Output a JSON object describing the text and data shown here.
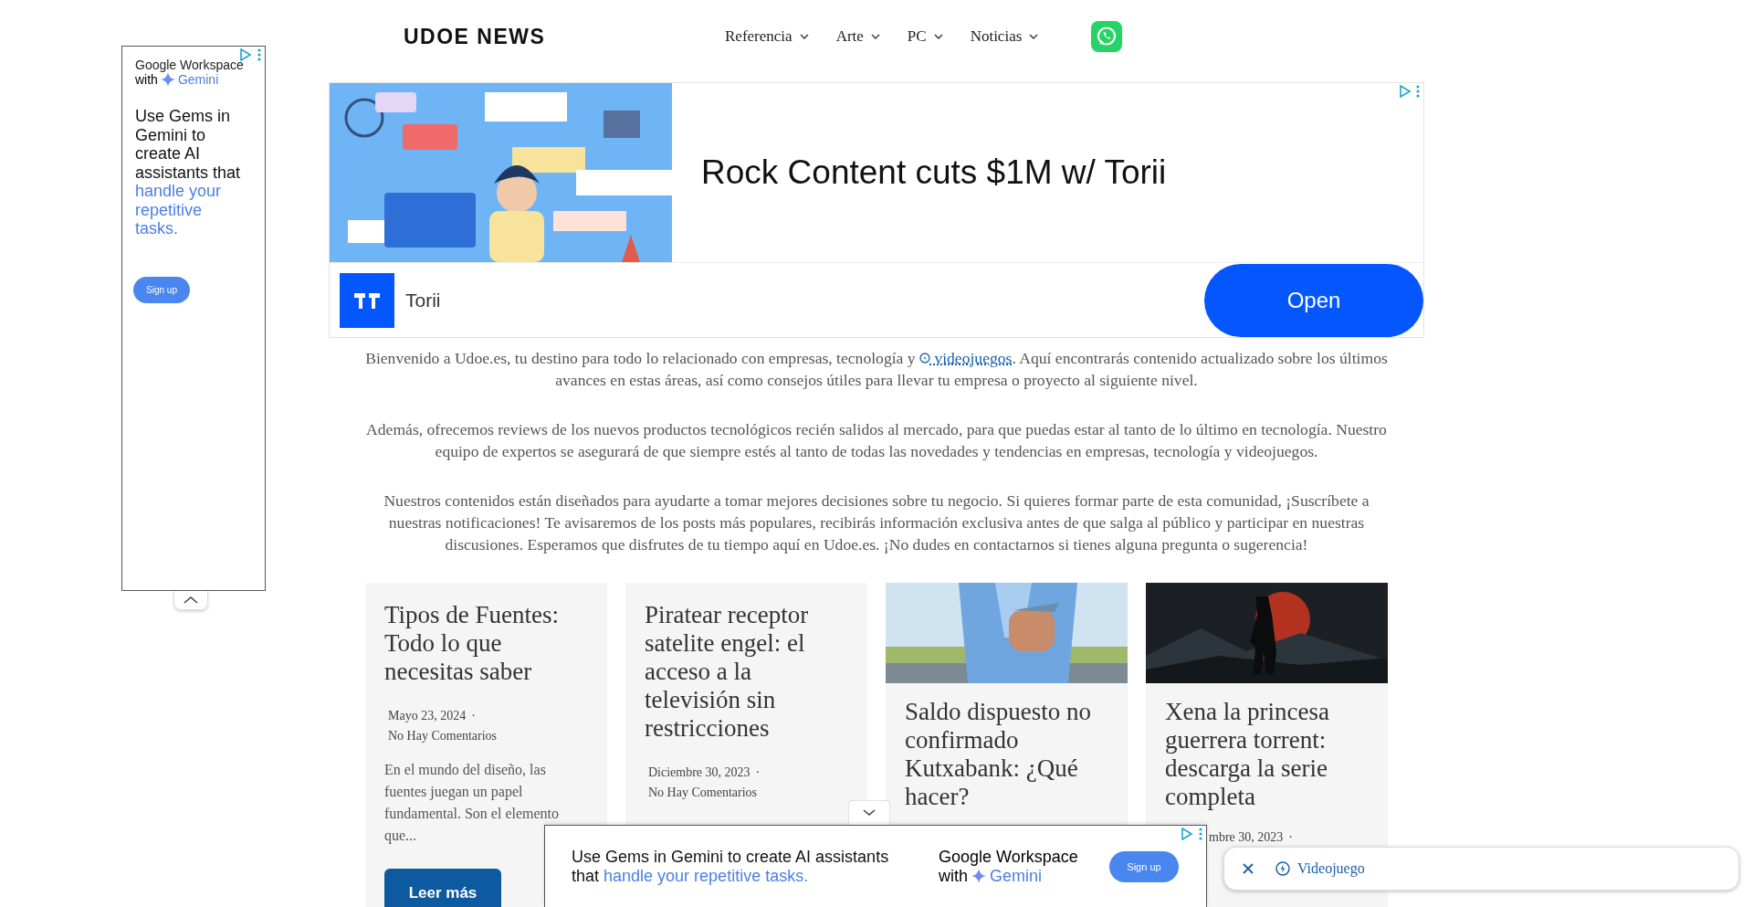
{
  "header": {
    "logo": "UDOE NEWS",
    "nav": [
      {
        "label": "Referencia"
      },
      {
        "label": "Arte"
      },
      {
        "label": "PC"
      },
      {
        "label": "Noticias"
      }
    ]
  },
  "side_ad": {
    "brand": "Google Workspace",
    "brand_with": "with",
    "brand_gemini": "Gemini",
    "headline": "Use Gems in Gemini to create AI assistants that",
    "headline_highlight": "handle your repetitive tasks.",
    "button": "Sign up"
  },
  "banner_ad": {
    "headline": "Rock Content cuts $1M w/ Torii",
    "advertiser": "Torii",
    "button": "Open"
  },
  "intro": {
    "lead": "Bienvenido a Udoe.es, tu destino para todo lo relacionado con empresas, tecnología y",
    "link": "videojuegos",
    "lead_rest": ". Aquí encontrarás contenido actualizado sobre los últimos avances en estas áreas, así como consejos útiles para llevar tu empresa o proyecto al siguiente nivel.",
    "paragraphs": [
      "Además, ofrecemos reviews de los nuevos productos tecnológicos recién salidos al mercado, para que puedas estar al tanto de lo último en tecnología. Nuestro equipo de expertos se asegurará de que siempre estés al tanto de todas las novedades y tendencias en empresas, tecnología y videojuegos.",
      "Nuestros contenidos están diseñados para ayudarte a tomar mejores decisiones sobre tu negocio. Si quieres formar parte de esta comunidad, ¡Suscríbete a nuestras notificaciones! Te avisaremos de los posts más populares, recibirás información exclusiva antes de que salga al público y participar en nuestras discusiones. Esperamos que disfrutes de tu tiempo aquí en Udoe.es. ¡No dudes en contactarnos si tienes alguna pregunta o sugerencia!"
    ]
  },
  "cards": [
    {
      "kind": "text",
      "title": "Tipos de Fuentes: Todo lo que necesitas saber",
      "date": "Mayo 23, 2024",
      "separator": "·",
      "comments": "No Hay Comentarios",
      "excerpt": "En el mundo del diseño, las fuentes juegan un papel fundamental. Son el elemento que...",
      "button": "Leer más"
    },
    {
      "kind": "text",
      "title": "Piratear receptor satelite engel: el acceso a la televisión sin restricciones",
      "date": "Diciembre 30, 2023",
      "separator": "·",
      "comments": "No Hay Comentarios"
    },
    {
      "kind": "office",
      "title": "Saldo dispuesto no confirmado Kutxabank: ¿Qué hacer?"
    },
    {
      "kind": "night",
      "title": "Xena la princesa guerrera torrent: descarga la serie completa",
      "date": "mbre 30, 2023",
      "separator": "·"
    }
  ],
  "bottom_ad": {
    "headline": "Use Gems in Gemini to create AI assistants that",
    "headline_highlight": "handle your repetitive tasks.",
    "brand": "Google Workspace",
    "brand_with": "with",
    "brand_gemini": "Gemini",
    "button": "Sign up"
  },
  "link_pill": {
    "label": "Videojuego"
  }
}
